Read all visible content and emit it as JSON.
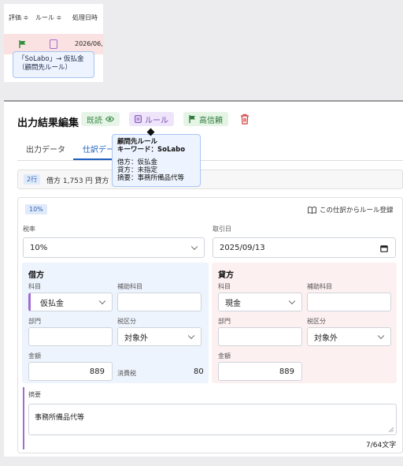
{
  "list": {
    "headers": [
      "評価 ≑",
      "ルール ≑",
      "処理日時"
    ],
    "row": {
      "date": "2026/06,"
    },
    "tooltip": [
      "「SoLabo」→ 仮払金",
      "（顧問先ルール）"
    ]
  },
  "editor": {
    "title": "出力結果編集",
    "badges": {
      "read": "既読",
      "rule": "ルール",
      "confidence": "高信頼"
    },
    "tooltip": {
      "line1": "顧問先ルール",
      "line2": "キーワード：SoLabo",
      "line3": "借方：仮払金",
      "line4": "貸方：未指定",
      "line5": "摘要：事務所備品代等"
    },
    "tabs": [
      "出力データ",
      "仕訳デー"
    ],
    "summary": {
      "rows": "2行",
      "text": "借方 1,753 円  貸方"
    },
    "entry": {
      "tax_chip": "10%",
      "register_rule": "この仕訳からルール登録",
      "more": "⋮",
      "tax_rate_label": "税率",
      "tax_rate_value": "10%",
      "date_label": "取引日",
      "date_value": "2025/09/13",
      "debit": {
        "title": "借方",
        "account_label": "科目",
        "account_value": "仮払金",
        "sub_label": "補助科目",
        "dept_label": "部門",
        "tax_cat_label": "税区分",
        "tax_cat_value": "対象外",
        "amount_label": "金額",
        "amount_value": "889",
        "tax_label": "消費税",
        "tax_value": "80"
      },
      "credit": {
        "title": "貸方",
        "account_label": "科目",
        "account_value": "現金",
        "sub_label": "補助科目",
        "dept_label": "部門",
        "tax_cat_label": "税区分",
        "tax_cat_value": "対象外",
        "amount_label": "金額",
        "amount_value": "889"
      },
      "memo_label": "摘要",
      "memo_value": "事務所備品代等",
      "memo_counter": "7/64文字"
    }
  }
}
